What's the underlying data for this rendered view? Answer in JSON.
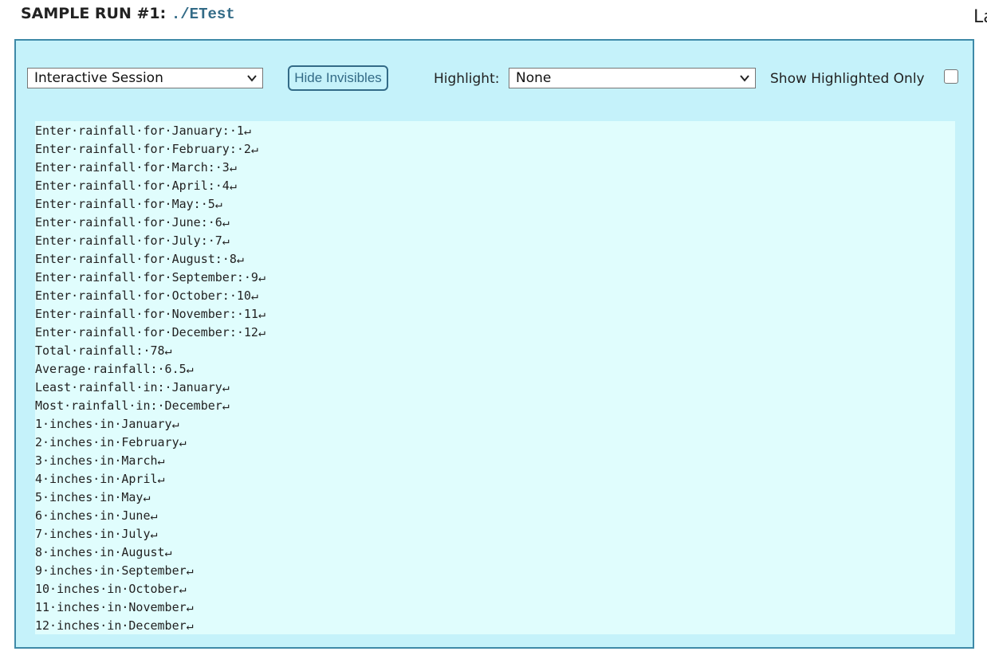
{
  "header": {
    "title": "SAMPLE RUN #1:",
    "command": "./ETest",
    "edge_text": "La"
  },
  "toolbar": {
    "session_select": {
      "value": "Interactive Session"
    },
    "hide_invisibles_label": "Hide Invisibles",
    "highlight_label": "Highlight:",
    "highlight_select": {
      "value": "None"
    },
    "show_highlighted_only_label": "Show Highlighted Only",
    "show_highlighted_only_checked": false
  },
  "icons": {
    "dropdown": "chevron-down-icon"
  },
  "colors": {
    "panel_bg": "#c5f2fa",
    "panel_border": "#3e8aa8",
    "output_bg": "#e0fdfd",
    "accent": "#336b87"
  },
  "output": {
    "lines": [
      "Enter·rainfall·for·January:·1↵",
      "Enter·rainfall·for·February:·2↵",
      "Enter·rainfall·for·March:·3↵",
      "Enter·rainfall·for·April:·4↵",
      "Enter·rainfall·for·May:·5↵",
      "Enter·rainfall·for·June:·6↵",
      "Enter·rainfall·for·July:·7↵",
      "Enter·rainfall·for·August:·8↵",
      "Enter·rainfall·for·September:·9↵",
      "Enter·rainfall·for·October:·10↵",
      "Enter·rainfall·for·November:·11↵",
      "Enter·rainfall·for·December:·12↵",
      "Total·rainfall:·78↵",
      "Average·rainfall:·6.5↵",
      "Least·rainfall·in:·January↵",
      "Most·rainfall·in:·December↵",
      "1·inches·in·January↵",
      "2·inches·in·February↵",
      "3·inches·in·March↵",
      "4·inches·in·April↵",
      "5·inches·in·May↵",
      "6·inches·in·June↵",
      "7·inches·in·July↵",
      "8·inches·in·August↵",
      "9·inches·in·September↵",
      "10·inches·in·October↵",
      "11·inches·in·November↵",
      "12·inches·in·December↵"
    ]
  }
}
